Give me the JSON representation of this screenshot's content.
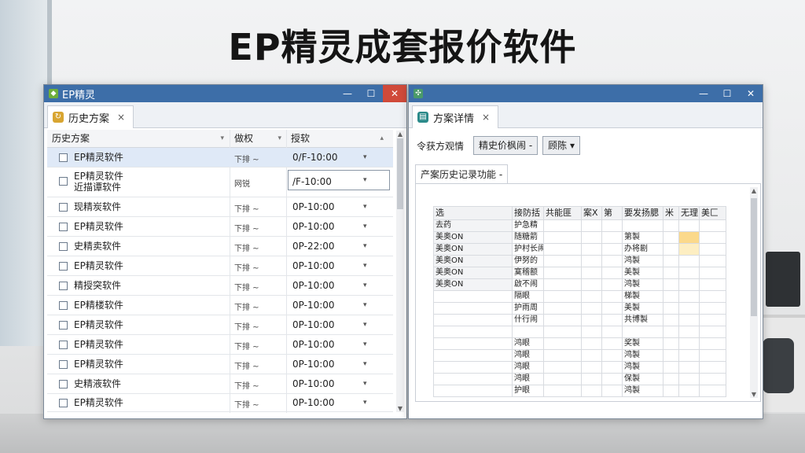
{
  "headline": "EP精灵成套报价软件",
  "left_window": {
    "title": "EP精灵",
    "tab_label": "历史方案",
    "tab_close": "×",
    "columns": [
      "历史方案",
      "做权",
      "授软"
    ],
    "rows": [
      {
        "name": "EP精灵软件",
        "sort": "下排 ~",
        "date": "0/F-10:00",
        "selected": true
      },
      {
        "name": "EP精灵软件",
        "name2": "近描谭软件",
        "sort": "网锐",
        "date": "/F-10:00",
        "boxed": true
      },
      {
        "name": "现精炭软件",
        "sort": "下排 ~",
        "date": "0P-10:00"
      },
      {
        "name": "EP精灵软件",
        "sort": "下排 ~",
        "date": "0P-10:00"
      },
      {
        "name": "史精卖软件",
        "sort": "下排 ~",
        "date": "0P-22:00"
      },
      {
        "name": "EP精灵软件",
        "sort": "下排 ~",
        "date": "0P-10:00"
      },
      {
        "name": "精授突软件",
        "sort": "下排 ~",
        "date": "0P-10:00"
      },
      {
        "name": "EP精楼软件",
        "sort": "下排 ~",
        "date": "0P-10:00"
      },
      {
        "name": "EP精灵软件",
        "sort": "下排 ~",
        "date": "0P-10:00"
      },
      {
        "name": "EP精灵软件",
        "sort": "下排 ~",
        "date": "0P-10:00"
      },
      {
        "name": "EP精灵软件",
        "sort": "下排 ~",
        "date": "0P-10:00"
      },
      {
        "name": "史精液软件",
        "sort": "下排 ~",
        "date": "0P-10:00"
      },
      {
        "name": "EP精灵软件",
        "sort": "下排 ~",
        "date": "0P-10:00"
      }
    ],
    "dropdown_arrow": "▾"
  },
  "right_window": {
    "tab_label": "方案详情",
    "tab_close": "×",
    "toolbar_label": "令获方观情",
    "btn1": "精史价枫闹 -",
    "btn2": "顾陈 ▾",
    "subtab_label": "产案历史记录功能 -",
    "sheet_header": [
      "选",
      "接防括",
      "共能匪",
      "案X",
      "第",
      "要发扬腮",
      "米",
      "无理",
      "美匚"
    ],
    "sheet_rows": [
      [
        "去药",
        "护急精",
        "",
        "",
        "",
        "",
        "",
        "",
        ""
      ],
      [
        "美奥ON",
        "随糖箭",
        "",
        "",
        "",
        "第製",
        "",
        "",
        ""
      ],
      [
        "美奥ON",
        "护村长闹",
        "",
        "",
        "",
        "办将剧",
        "",
        "",
        ""
      ],
      [
        "美奥ON",
        "伊努的",
        "",
        "",
        "",
        "鸿製",
        "",
        "",
        ""
      ],
      [
        "美奥ON",
        "寞稽额",
        "",
        "",
        "",
        "美製",
        "",
        "",
        ""
      ],
      [
        "美奥ON",
        "啟不闹",
        "",
        "",
        "",
        "鸿製",
        "",
        "",
        ""
      ],
      [
        "",
        "隔眼",
        "",
        "",
        "",
        "梯製",
        "",
        "",
        ""
      ],
      [
        "",
        "护雨周",
        "",
        "",
        "",
        "美製",
        "",
        "",
        ""
      ],
      [
        "",
        "什行闹",
        "",
        "",
        "",
        "共博製",
        "",
        "",
        ""
      ],
      [
        "",
        "",
        "",
        "",
        "",
        "",
        "",
        "",
        ""
      ],
      [
        "",
        "鸿眼",
        "",
        "",
        "",
        "奖製",
        "",
        "",
        ""
      ],
      [
        "",
        "鸿眼",
        "",
        "",
        "",
        "鸿製",
        "",
        "",
        ""
      ],
      [
        "",
        "鸿眼",
        "",
        "",
        "",
        "鸿製",
        "",
        "",
        ""
      ],
      [
        "",
        "鸿眼",
        "",
        "",
        "",
        "保製",
        "",
        "",
        ""
      ],
      [
        "",
        "护眼",
        "",
        "",
        "",
        "鸿製",
        "",
        "",
        ""
      ]
    ]
  },
  "window_controls": {
    "min": "—",
    "max": "☐",
    "close": "✕"
  }
}
